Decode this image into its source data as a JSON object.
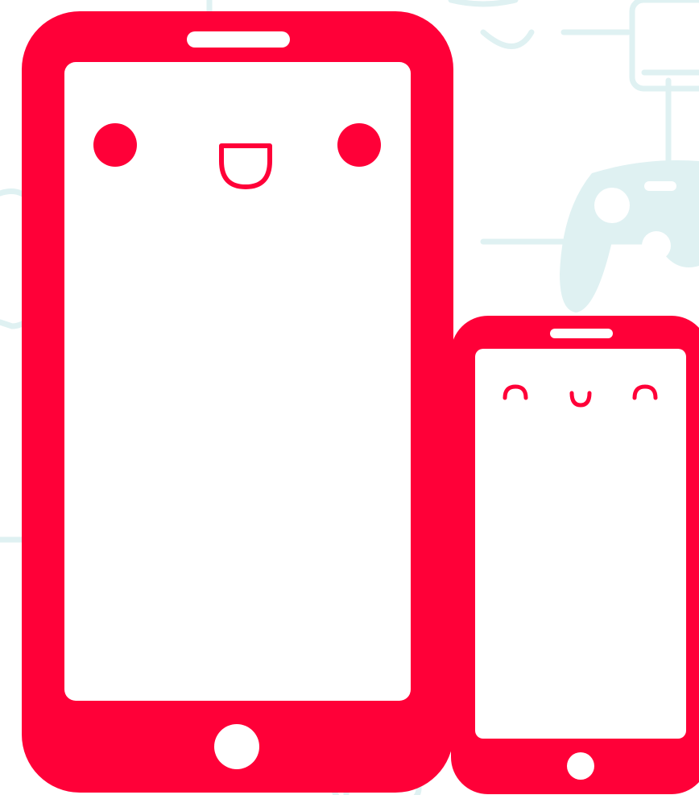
{
  "colors": {
    "phone_red": "#ff0038",
    "screen_white": "#ffffff",
    "pattern_tint": "#dff1f2",
    "pattern_tint_dark": "#cfe9eb"
  },
  "background": {
    "pattern": "game-controllers-and-phones",
    "icons": [
      "phone-outline-icon",
      "gamepad-outline-icon"
    ]
  },
  "characters": [
    {
      "name": "large-phone",
      "expression": "open-mouth-smile"
    },
    {
      "name": "small-phone",
      "expression": "happy-closed-eyes"
    }
  ]
}
